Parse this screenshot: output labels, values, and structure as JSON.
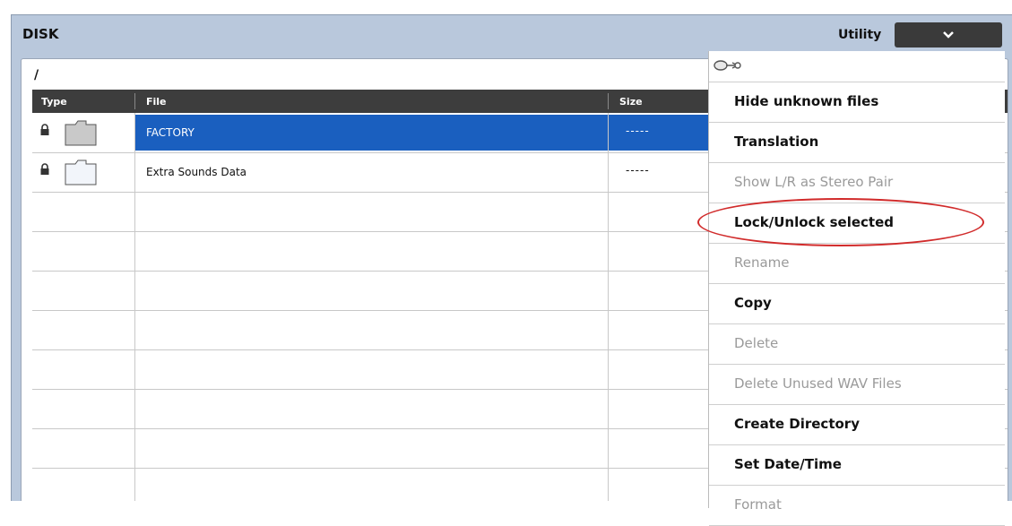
{
  "header": {
    "title": "DISK",
    "utility_label": "Utility"
  },
  "browser": {
    "path": "/",
    "columns": [
      "Type",
      "File",
      "Size"
    ],
    "rows": [
      {
        "name": "FACTORY",
        "size": "-----",
        "locked": true,
        "selected": true
      },
      {
        "name": "Extra Sounds Data",
        "size": "-----",
        "locked": true,
        "selected": false
      }
    ]
  },
  "utility_menu": {
    "items": [
      {
        "label": "Hide unknown files",
        "enabled": true
      },
      {
        "label": "Translation",
        "enabled": true
      },
      {
        "label": "Show L/R as Stereo Pair",
        "enabled": false
      },
      {
        "label": "Lock/Unlock selected",
        "enabled": true
      },
      {
        "label": "Rename",
        "enabled": false
      },
      {
        "label": "Copy",
        "enabled": true
      },
      {
        "label": "Delete",
        "enabled": false
      },
      {
        "label": "Delete Unused WAV Files",
        "enabled": false
      },
      {
        "label": "Create Directory",
        "enabled": true
      },
      {
        "label": "Set Date/Time",
        "enabled": true
      },
      {
        "label": "Format",
        "enabled": false
      }
    ]
  },
  "colors": {
    "selection": "#1a5fbf",
    "frame": "#b9c8dc",
    "header_bar": "#3d3d3d",
    "annotation_circle": "#d12b2b"
  }
}
